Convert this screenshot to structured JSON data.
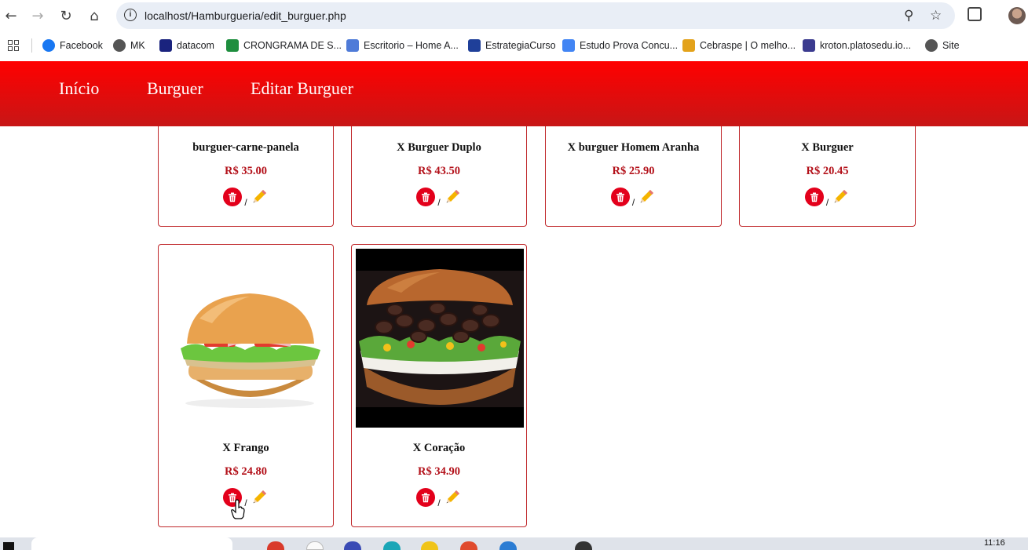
{
  "browser": {
    "url": "localhost/Hamburgueria/edit_burguer.php",
    "bookmarks": [
      {
        "label": "Facebook",
        "color": "#1877f2"
      },
      {
        "label": "MK",
        "color": "#555555"
      },
      {
        "label": "datacom",
        "color": "#1a237e"
      },
      {
        "label": "CRONGRAMA DE S...",
        "color": "#1e8e3e"
      },
      {
        "label": "Escritorio – Home A...",
        "color": "#4f7bd8"
      },
      {
        "label": "EstrategiaCurso",
        "color": "#1f3f99"
      },
      {
        "label": "Estudo Prova Concu...",
        "color": "#4285f4"
      },
      {
        "label": "Cebraspe | O melho...",
        "color": "#e3a21a"
      },
      {
        "label": "kroton.platosedu.io...",
        "color": "#3b3b8f"
      },
      {
        "label": "Site",
        "color": "#555555"
      }
    ]
  },
  "header": {
    "nav": [
      "Início",
      "Burguer",
      "Editar Burguer"
    ]
  },
  "cards": [
    {
      "name": "burguer-carne-panela",
      "price": "R$ 35.00"
    },
    {
      "name": "X Burguer Duplo",
      "price": "R$ 43.50"
    },
    {
      "name": "X burguer Homem Aranha",
      "price": "R$ 25.90"
    },
    {
      "name": "X Burguer",
      "price": "R$ 20.45"
    },
    {
      "name": "X Frango",
      "price": "R$ 24.80",
      "image": "burger-chicken-image"
    },
    {
      "name": "X Coração",
      "price": "R$ 34.90",
      "image": "burger-heart-image"
    }
  ],
  "action_separator": "/",
  "taskbar": {
    "clock": "11:16"
  },
  "colors": {
    "header_top": "#ff0000",
    "header_bottom": "#c71616",
    "card_border": "#c0282b",
    "price": "#b3111a",
    "delete_button": "#e3001b"
  }
}
